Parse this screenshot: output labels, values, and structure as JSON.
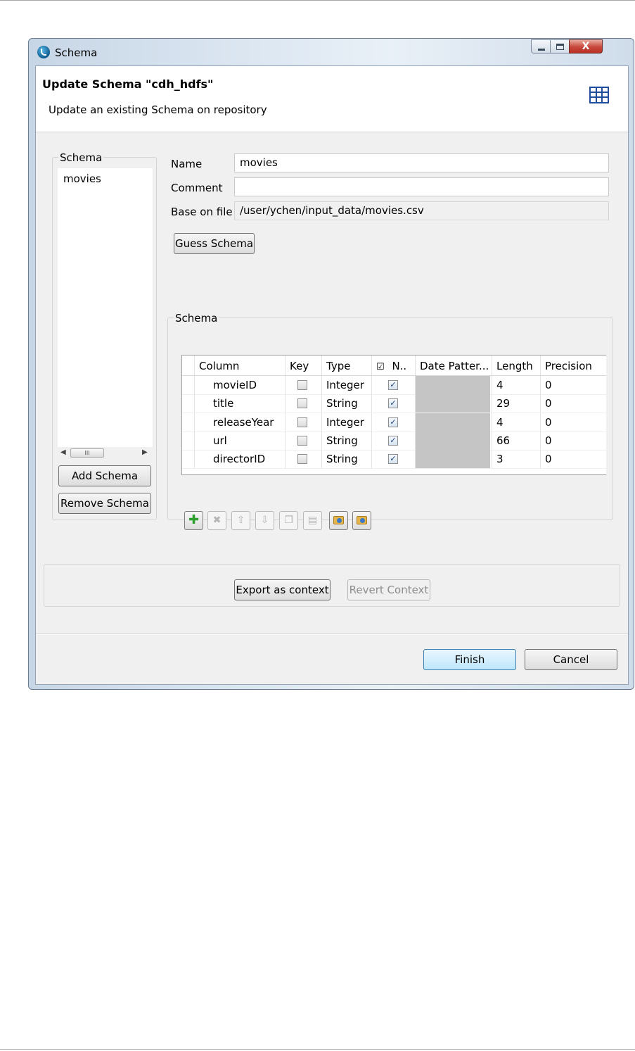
{
  "window": {
    "title": "Schema"
  },
  "header": {
    "title": "Update Schema \"cdh_hdfs\"",
    "description": "Update an existing Schema on repository",
    "icon": "table-icon"
  },
  "left_panel": {
    "group_label": "Schema",
    "items": [
      "movies"
    ],
    "add_button": "Add Schema",
    "remove_button": "Remove Schema"
  },
  "form": {
    "name_label": "Name",
    "name_value": "movies",
    "comment_label": "Comment",
    "comment_value": "",
    "base_label": "Base on file",
    "base_value": "/user/ychen/input_data/movies.csv",
    "guess_button": "Guess Schema"
  },
  "schema_table": {
    "group_label": "Schema",
    "nullable_header_checked": true,
    "columns": [
      "Column",
      "Key",
      "Type",
      "N..",
      "Date Patter...",
      "Length",
      "Precision"
    ],
    "rows": [
      {
        "column": "movieID",
        "key": false,
        "type": "Integer",
        "nullable": true,
        "date_pattern": "",
        "length": "4",
        "precision": "0"
      },
      {
        "column": "title",
        "key": false,
        "type": "String",
        "nullable": true,
        "date_pattern": "",
        "length": "29",
        "precision": "0"
      },
      {
        "column": "releaseYear",
        "key": false,
        "type": "Integer",
        "nullable": true,
        "date_pattern": "",
        "length": "4",
        "precision": "0"
      },
      {
        "column": "url",
        "key": false,
        "type": "String",
        "nullable": true,
        "date_pattern": "",
        "length": "66",
        "precision": "0"
      },
      {
        "column": "directorID",
        "key": false,
        "type": "String",
        "nullable": true,
        "date_pattern": "",
        "length": "3",
        "precision": "0"
      }
    ]
  },
  "toolbar": [
    {
      "icon": "add-row-icon",
      "enabled": true
    },
    {
      "icon": "delete-row-icon",
      "enabled": false
    },
    {
      "icon": "move-up-icon",
      "enabled": false
    },
    {
      "icon": "move-down-icon",
      "enabled": false
    },
    {
      "icon": "copy-icon",
      "enabled": false
    },
    {
      "icon": "paste-icon",
      "enabled": false
    },
    {
      "icon": "import-schema-icon",
      "enabled": true
    },
    {
      "icon": "export-schema-icon",
      "enabled": true
    }
  ],
  "context": {
    "export_button": "Export as context",
    "revert_button": "Revert Context"
  },
  "footer": {
    "finish_button": "Finish",
    "cancel_button": "Cancel"
  },
  "colors": {
    "accent": "#3c7fb1",
    "icon_blue": "#1f4f9c",
    "add_green": "#2e9f2e",
    "close_red": "#c7453a",
    "disabled_cell": "#c5c5c5"
  }
}
